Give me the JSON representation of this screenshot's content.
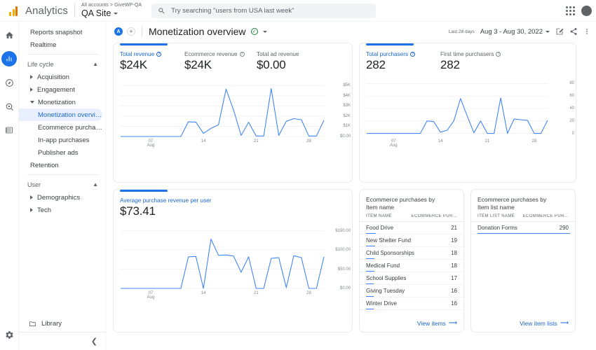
{
  "topbar": {
    "brand": "Analytics",
    "account_breadcrumb": "All accounts  >  GiveWP-QA",
    "property": "QA Site",
    "search_placeholder": "Try searching \"users from USA last week\"",
    "apps_icon": "apps-grid-icon",
    "avatar_icon": "account-avatar"
  },
  "rail": {
    "items": [
      {
        "name": "home-icon",
        "label": "Home"
      },
      {
        "name": "reports-icon",
        "label": "Reports",
        "active": true
      },
      {
        "name": "explore-icon",
        "label": "Explore"
      },
      {
        "name": "advertising-icon",
        "label": "Advertising"
      },
      {
        "name": "configure-icon",
        "label": "Configure"
      }
    ],
    "settings_icon": "gear-icon"
  },
  "sidebar": {
    "top_items": [
      "Reports snapshot",
      "Realtime"
    ],
    "sections": [
      {
        "title": "Life cycle",
        "items": [
          {
            "label": "Acquisition",
            "expanded": false
          },
          {
            "label": "Engagement",
            "expanded": false
          },
          {
            "label": "Monetization",
            "expanded": true,
            "children": [
              "Monetization overview",
              "Ecommerce purchases",
              "In-app purchases",
              "Publisher ads"
            ]
          },
          {
            "label": "Retention",
            "leaf": true
          }
        ]
      },
      {
        "title": "User",
        "items": [
          {
            "label": "Demographics",
            "expanded": false
          },
          {
            "label": "Tech",
            "expanded": false
          }
        ]
      }
    ],
    "selected": "Monetization overview",
    "library_label": "Library",
    "library_icon": "folder-icon",
    "collapse_icon": "chevron-left-icon"
  },
  "header": {
    "avatar_initial": "A",
    "add_label": "+",
    "title": "Monetization overview",
    "verified_icon": "check-circle-icon",
    "title_caret": "chevron-down-icon",
    "last_days": "Last 28 days",
    "date_range": "Aug 3 - Aug 30, 2022",
    "edit_icon": "edit-square-icon",
    "share_icon": "share-icon",
    "more_icon": "more-vert-icon"
  },
  "cards": {
    "revenue": {
      "metrics": [
        {
          "label": "Total revenue",
          "value": "$24K",
          "has_help": true,
          "primary": true
        },
        {
          "label": "Ecommerce revenue",
          "value": "$24K",
          "has_help": true,
          "primary": false
        },
        {
          "label": "Total ad revenue",
          "value": "$0.00",
          "has_help": false,
          "primary": false
        }
      ]
    },
    "purchasers": {
      "metrics": [
        {
          "label": "Total purchasers",
          "value": "282",
          "has_help": true,
          "primary": true
        },
        {
          "label": "First time purchasers",
          "value": "282",
          "has_help": true,
          "primary": false
        }
      ]
    },
    "arpu": {
      "metrics": [
        {
          "label": "Average purchase revenue per user",
          "value": "$73.41",
          "has_help": false,
          "primary": true
        }
      ]
    },
    "item_name": {
      "title_line1": "Ecommerce purchases by",
      "title_line2": "Item name",
      "col1": "ITEM NAME",
      "col2": "ECOMMERCE PUR...",
      "rows": [
        {
          "name": "Food Drive",
          "value": "21"
        },
        {
          "name": "New Shelter Fund",
          "value": "19"
        },
        {
          "name": "Child Sponsorships",
          "value": "18"
        },
        {
          "name": "Medical Fund",
          "value": "18"
        },
        {
          "name": "School Supplies",
          "value": "17"
        },
        {
          "name": "Giving Tuesday",
          "value": "16"
        },
        {
          "name": "Winter Drive",
          "value": "16"
        }
      ],
      "footer": "View items",
      "footer_icon": "arrow-right-icon"
    },
    "item_list": {
      "title_line1": "Ecommerce purchases by",
      "title_line2": "Item list name",
      "col1": "ITEM LIST NAME",
      "col2": "ECOMMERCE PUR...",
      "rows": [
        {
          "name": "Donation Forms",
          "value": "290"
        }
      ],
      "footer": "View item lists",
      "footer_icon": "arrow-right-icon"
    }
  },
  "colors": {
    "accent": "#1a73e8",
    "line": "#4285f4",
    "selected_bg": "#e8f0fe",
    "text": "#202124",
    "muted": "#5f6368",
    "logo_orange": "#f9ab00"
  },
  "chart_data": [
    {
      "id": "revenue",
      "type": "line",
      "title": "Total revenue",
      "xlabel": "Aug",
      "ylabel": "",
      "ylim": [
        0,
        5500
      ],
      "ytick_labels": [
        "$0.00",
        "$1K",
        "$2K",
        "$3K",
        "$4K",
        "$5K"
      ],
      "yticks": [
        0,
        1000,
        2000,
        3000,
        4000,
        5000
      ],
      "xtick_labels": [
        "07\nAug",
        "14",
        "21",
        "28"
      ],
      "xticks": [
        4,
        11,
        18,
        25
      ],
      "x": [
        1,
        2,
        3,
        4,
        5,
        6,
        7,
        8,
        9,
        10,
        11,
        12,
        13,
        14,
        15,
        16,
        17,
        18,
        19,
        20,
        21,
        22,
        23,
        24,
        25,
        26,
        27,
        28
      ],
      "values": [
        0,
        0,
        0,
        0,
        0,
        0,
        0,
        0,
        0,
        1450,
        1400,
        300,
        800,
        1150,
        4650,
        2600,
        100,
        1400,
        50,
        50,
        4700,
        100,
        1500,
        1750,
        1650,
        50,
        50,
        1600
      ]
    },
    {
      "id": "purchasers",
      "type": "line",
      "title": "Total purchasers",
      "xlabel": "Aug",
      "ylabel": "",
      "ylim": [
        -5,
        85
      ],
      "ytick_labels": [
        "0",
        "20",
        "40",
        "60",
        "80"
      ],
      "yticks": [
        0,
        20,
        40,
        60,
        80
      ],
      "xtick_labels": [
        "07\nAug",
        "14",
        "21",
        "28"
      ],
      "xticks": [
        4,
        11,
        18,
        25
      ],
      "x": [
        1,
        2,
        3,
        4,
        5,
        6,
        7,
        8,
        9,
        10,
        11,
        12,
        13,
        14,
        15,
        16,
        17,
        18,
        19,
        20,
        21,
        22,
        23,
        24,
        25,
        26,
        27,
        28
      ],
      "values": [
        0,
        0,
        0,
        0,
        0,
        0,
        0,
        0,
        0,
        20,
        19,
        2,
        5,
        20,
        56,
        28,
        1,
        20,
        0,
        0,
        57,
        0,
        23,
        22,
        21,
        0,
        0,
        21
      ]
    },
    {
      "id": "arpu",
      "type": "line",
      "title": "Average purchase revenue per user",
      "xlabel": "Aug",
      "ylabel": "",
      "ylim": [
        0,
        160
      ],
      "ytick_labels": [
        "$0.00",
        "$50.00",
        "$100.00",
        "$150.00"
      ],
      "yticks": [
        0,
        50,
        100,
        150
      ],
      "xtick_labels": [
        "07\nAug",
        "14",
        "21",
        "28"
      ],
      "xticks": [
        4,
        11,
        18,
        25
      ],
      "x": [
        1,
        2,
        3,
        4,
        5,
        6,
        7,
        8,
        9,
        10,
        11,
        12,
        13,
        14,
        15,
        16,
        17,
        18,
        19,
        20,
        21,
        22,
        23,
        24,
        25,
        26,
        27,
        28
      ],
      "values": [
        0,
        0,
        0,
        0,
        0,
        0,
        0,
        0,
        0,
        82,
        83,
        0,
        128,
        86,
        87,
        84,
        42,
        82,
        0,
        0,
        78,
        80,
        2,
        85,
        80,
        0,
        0,
        82
      ]
    }
  ]
}
